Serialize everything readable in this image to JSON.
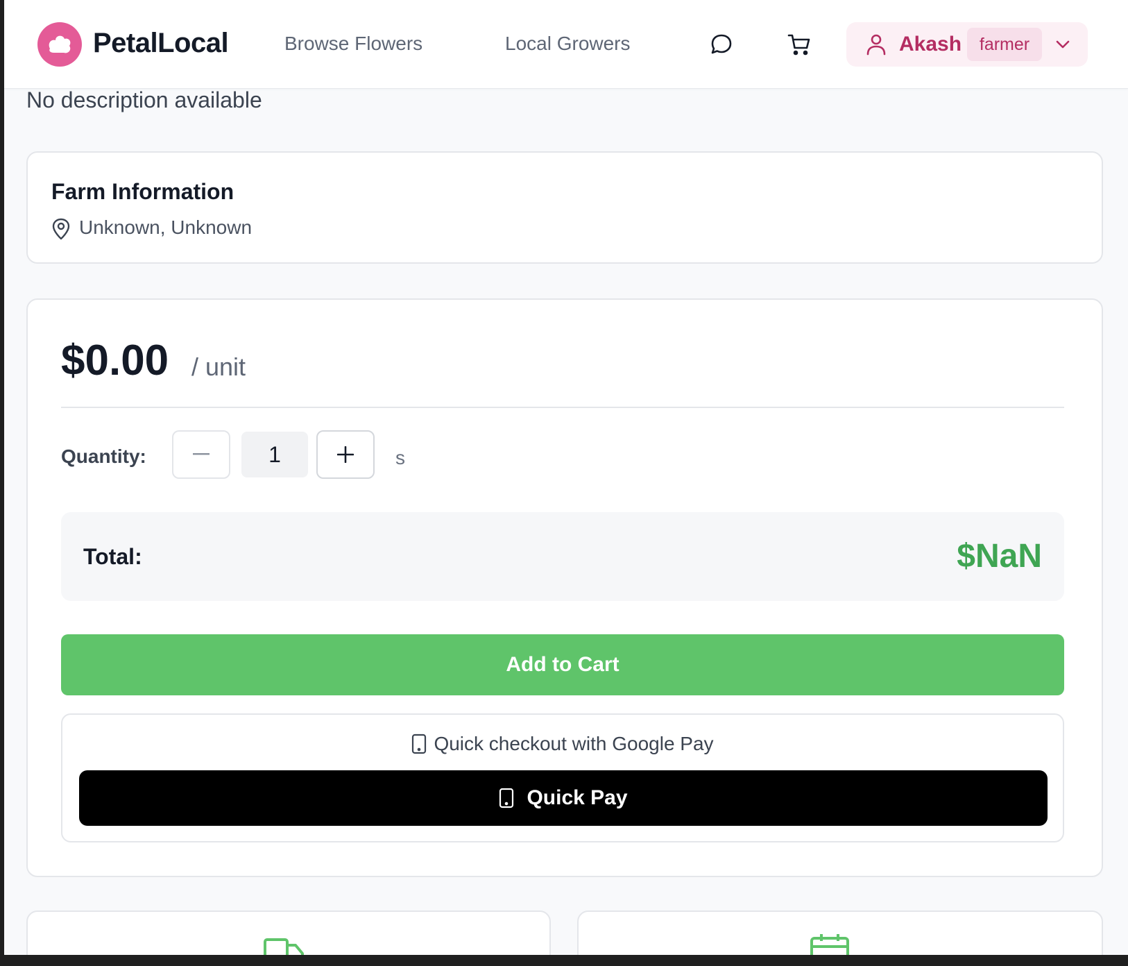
{
  "header": {
    "brand": "PetalLocal",
    "nav": [
      {
        "label": "Browse Flowers"
      },
      {
        "label": "Local Growers"
      }
    ],
    "user": {
      "name": "Akash",
      "role": "farmer"
    },
    "icons": {
      "logo": "petal-logo-icon",
      "messages": "chat-bubble-icon",
      "cart": "shopping-cart-icon",
      "user": "user-icon",
      "menu": "chevron-down-icon"
    }
  },
  "product": {
    "description": "No description available"
  },
  "farm": {
    "title": "Farm Information",
    "location": "Unknown, Unknown",
    "icon": "map-pin-icon"
  },
  "purchase": {
    "price": "$0.00",
    "unit_label": "/ unit",
    "quantity_label": "Quantity:",
    "minus_label": "−",
    "plus_label": "+",
    "quantity_value": "1",
    "quantity_unit": "s",
    "total_label": "Total:",
    "total_value": "$NaN",
    "add_to_cart": "Add to Cart",
    "gpay_note": "Quick checkout with Google Pay",
    "quick_pay": "Quick Pay"
  },
  "info_cards": [
    {
      "icon": "truck-icon"
    },
    {
      "icon": "calendar-icon"
    }
  ],
  "colors": {
    "brand_pink": "#e45b97",
    "user_pink": "#b42d62",
    "green": "#5fc46a",
    "total_green": "#3fa553",
    "black": "#000000"
  }
}
